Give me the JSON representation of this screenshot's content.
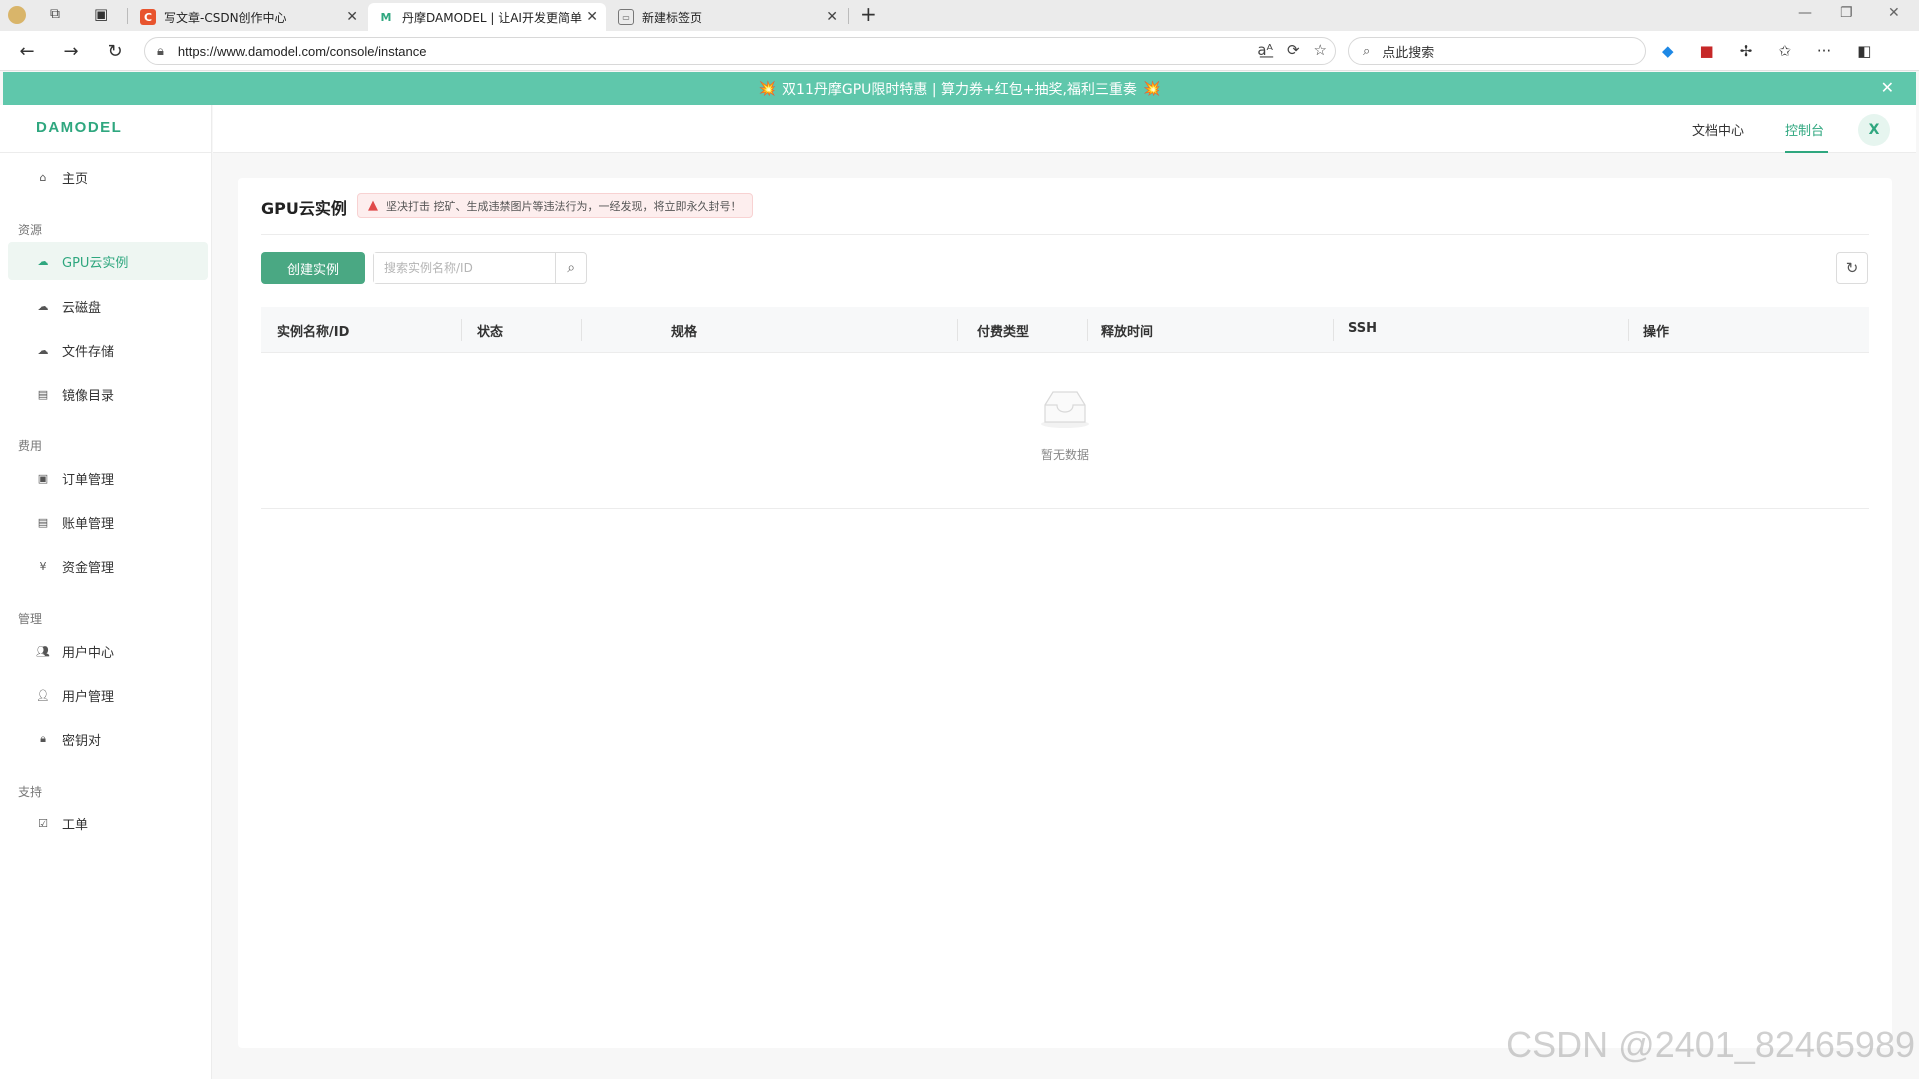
{
  "browser": {
    "tabs": [
      {
        "label": "写文章-CSDN创作中心",
        "favicon": "C"
      },
      {
        "label": "丹摩DAMODEL | 让AI开发更简单",
        "favicon": "M"
      },
      {
        "label": "新建标签页",
        "favicon": "▭"
      }
    ],
    "url": "https://www.damodel.com/console/instance",
    "search_placeholder": "点此搜索"
  },
  "banner": {
    "text": "双11丹摩GPU限时特惠 | 算力券+红包+抽奖,福利三重奏",
    "emoji": "💥"
  },
  "sidebar": {
    "logo": "DAMODEL",
    "home": "主页",
    "groups": [
      {
        "title": "资源",
        "items": [
          "GPU云实例",
          "云磁盘",
          "文件存储",
          "镜像目录"
        ]
      },
      {
        "title": "费用",
        "items": [
          "订单管理",
          "账单管理",
          "资金管理"
        ]
      },
      {
        "title": "管理",
        "items": [
          "用户中心",
          "用户管理",
          "密钥对"
        ]
      },
      {
        "title": "支持",
        "items": [
          "工单"
        ]
      }
    ]
  },
  "header": {
    "docs": "文档中心",
    "console": "控制台",
    "avatar": "X"
  },
  "main": {
    "title": "GPU云实例",
    "warning": "坚决打击 挖矿、生成违禁图片等违法行为，一经发现，将立即永久封号！",
    "create_button": "创建实例",
    "search_placeholder": "搜索实例名称/ID",
    "columns": [
      "实例名称/ID",
      "状态",
      "规格",
      "付费类型",
      "释放时间",
      "SSH",
      "操作"
    ],
    "empty_text": "暂无数据"
  },
  "watermark": "CSDN @2401_82465989",
  "colors": {
    "accent": "#4aa883",
    "banner": "#5fc7ab",
    "warning": "#e04b4b"
  }
}
